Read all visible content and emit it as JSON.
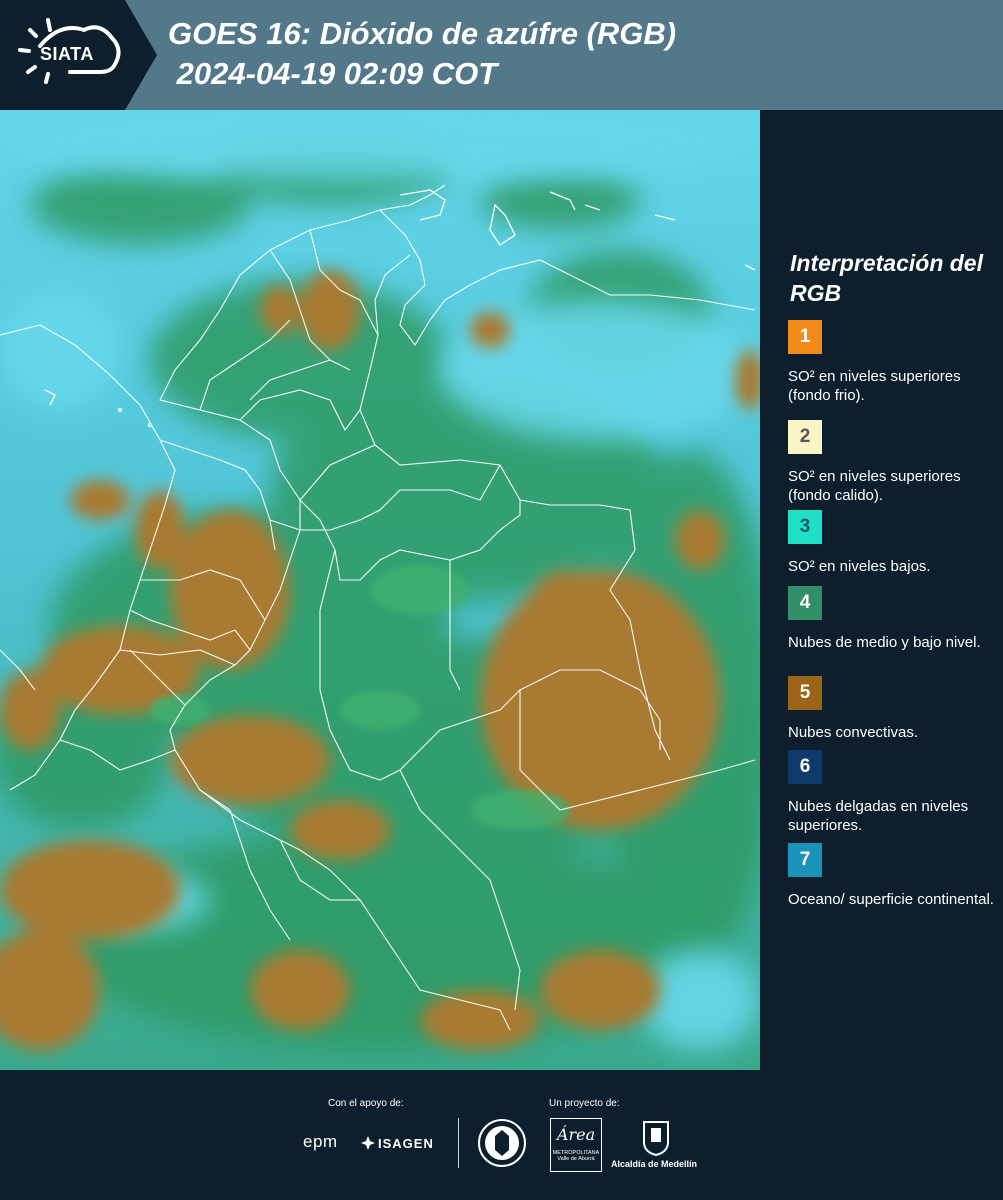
{
  "header": {
    "logo_text": "SIATA",
    "title_line1": "GOES 16: Dióxido de azúfre (RGB)",
    "title_line2": " 2024-04-19 02:09 COT"
  },
  "colors": {
    "header_bg": "#52788a",
    "panel_bg": "#0d1f2d",
    "ocean_cyan": "#5ad2e4",
    "convective_brown": "#a87a30",
    "midlevel_green": "#2f9a63"
  },
  "legend": {
    "title": "Interpretación del RGB",
    "items": [
      {
        "num": "1",
        "color": "#f28a1c",
        "text_color": "#ffffff",
        "label": "SO² en niveles superiores (fondo frio)."
      },
      {
        "num": "2",
        "color": "#fbf4c6",
        "text_color": "#555555",
        "label": "SO² en niveles superiores (fondo calido)."
      },
      {
        "num": "3",
        "color": "#1fe0c6",
        "text_color": "#1c5c60",
        "label": "SO² en niveles bajos."
      },
      {
        "num": "4",
        "color": "#2f8f67",
        "text_color": "#ffffff",
        "label": "Nubes de medio y bajo nivel."
      },
      {
        "num": "5",
        "color": "#9b6416",
        "text_color": "#ffffff",
        "label": "Nubes convectivas."
      },
      {
        "num": "6",
        "color": "#0e3a6c",
        "text_color": "#ffffff",
        "label": "Nubes delgadas en niveles superiores."
      },
      {
        "num": "7",
        "color": "#1a93bb",
        "text_color": "#ffffff",
        "label": "Oceano/ superficie continental."
      }
    ]
  },
  "footer": {
    "support_label": "Con el apoyo de:",
    "project_label": "Un proyecto de:",
    "partner_epm": "epm",
    "partner_isagen": "ISAGEN",
    "partner_area_script": "Área",
    "partner_area_line1": "METROPOLITANA",
    "partner_area_line2": "Valle de Aburrá",
    "partner_alcaldia": "Alcaldía de Medellín"
  }
}
